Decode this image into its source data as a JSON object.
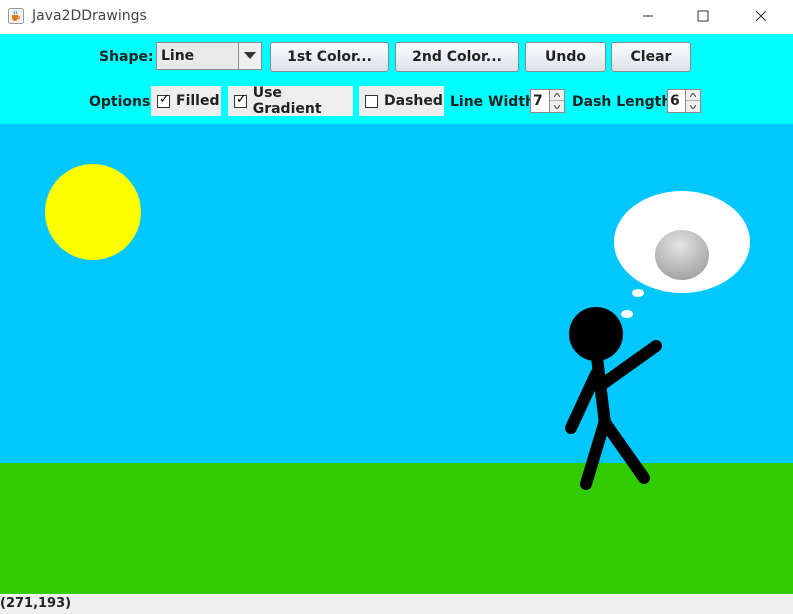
{
  "window": {
    "title": "Java2DDrawings",
    "icon": "java-coffee-cup-icon"
  },
  "toolbar": {
    "shape_label": "Shape:",
    "shape_selected": "Line",
    "first_color_label": "1st Color...",
    "second_color_label": "2nd Color...",
    "undo_label": "Undo",
    "clear_label": "Clear",
    "options_label": "Options",
    "filled_label": "Filled",
    "filled_checked": true,
    "gradient_label": "Use Gradient",
    "gradient_checked": true,
    "dashed_label": "Dashed",
    "dashed_checked": false,
    "line_width_label": "Line Width",
    "line_width_value": "7",
    "dash_length_label": "Dash Length",
    "dash_length_value": "6"
  },
  "colors": {
    "toolbar_bg": "#00FFFF",
    "sky": "#00C8FF",
    "grass": "#2ECC00",
    "sun": "#FFFF00",
    "figure": "#000000",
    "cloud": "#FFFFFF"
  },
  "drawing": {
    "scene": "sky, sun, grass, stick figure with thought bubble"
  },
  "status": {
    "coordinates": "(271,193)"
  }
}
